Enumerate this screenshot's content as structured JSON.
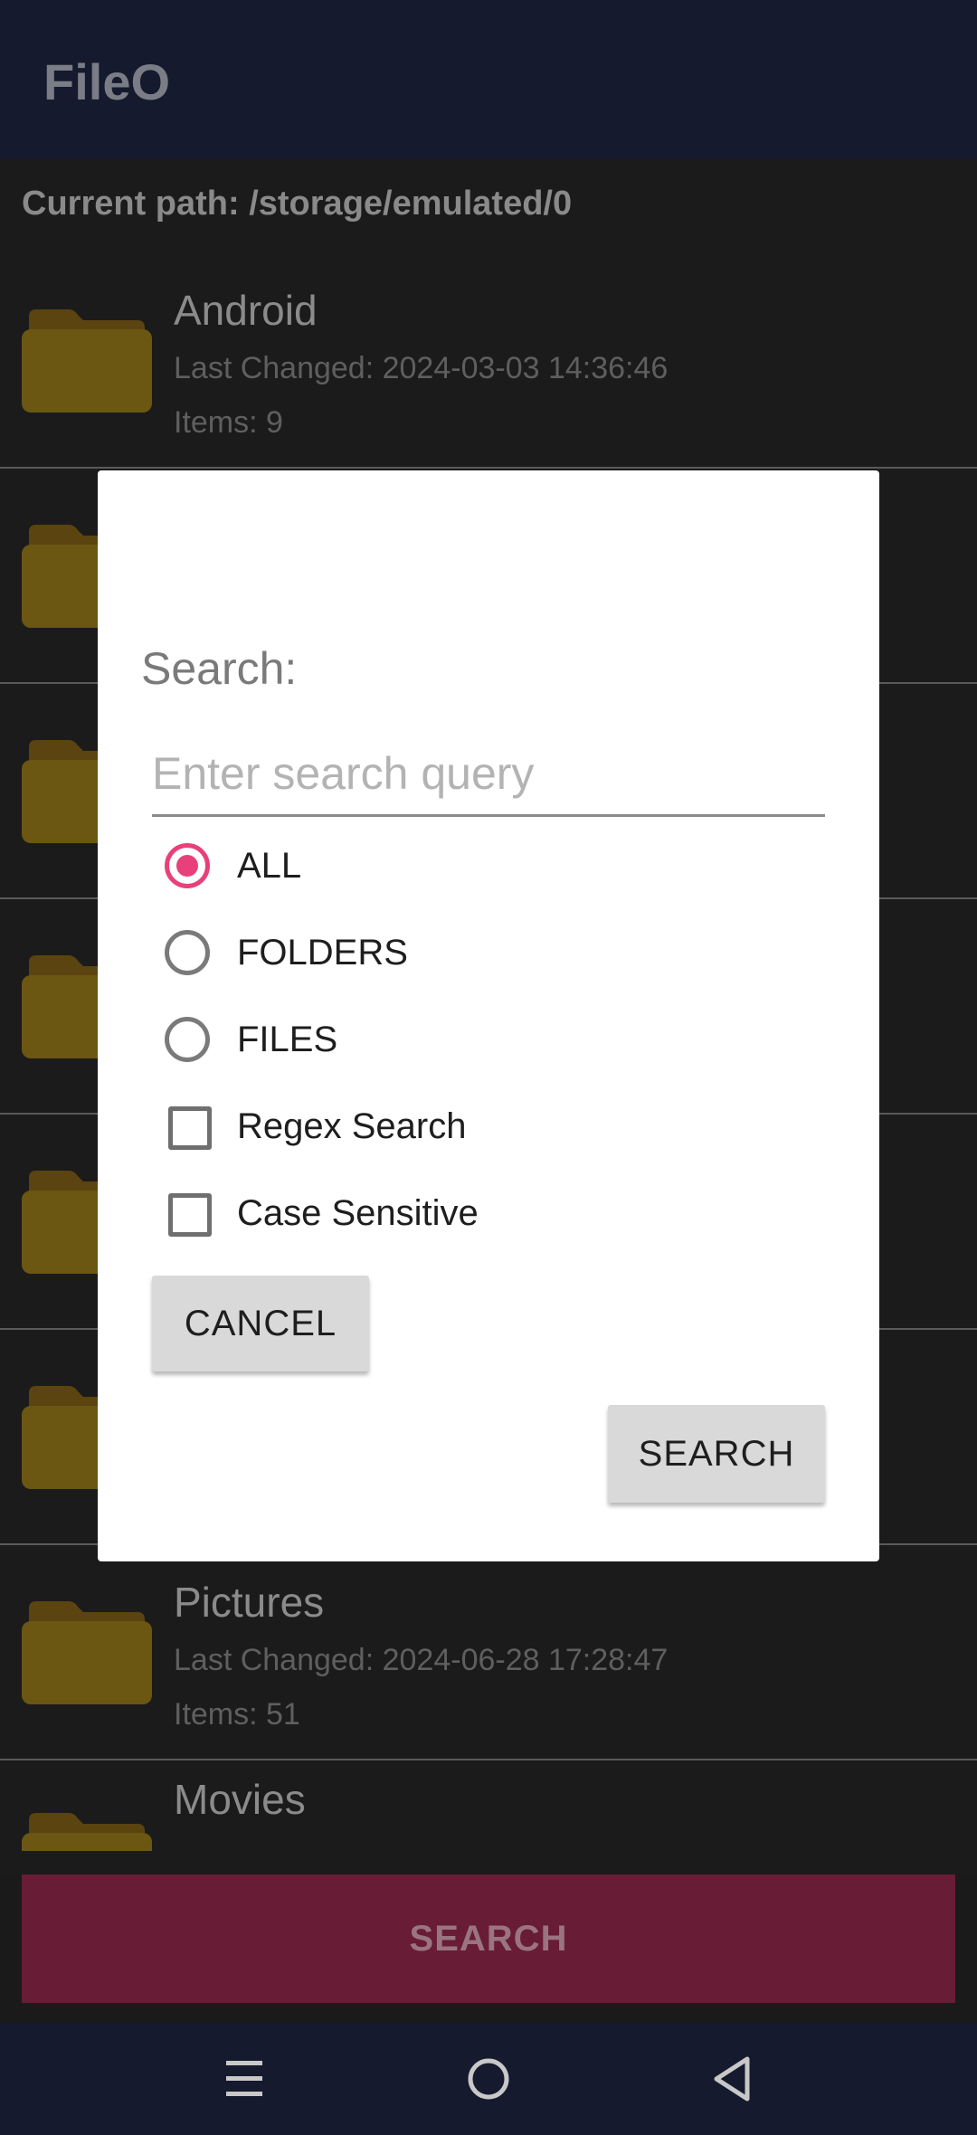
{
  "app": {
    "title": "FileO"
  },
  "path": {
    "label": "Current path: /storage/emulated/0"
  },
  "folders": [
    {
      "name": "Android",
      "date": "Last Changed: 2024-03-03 14:36:46",
      "items": "Items: 9"
    },
    {
      "name": "Pictures",
      "date": "Last Changed: 2024-06-28 17:28:47",
      "items": "Items: 51"
    },
    {
      "name": "Movies"
    }
  ],
  "dialog": {
    "search_label": "Search:",
    "input": {
      "placeholder": "Enter search query",
      "value": ""
    },
    "options": [
      {
        "label": "ALL",
        "type": "radio",
        "checked": true
      },
      {
        "label": "FOLDERS",
        "type": "radio",
        "checked": false
      },
      {
        "label": "FILES",
        "type": "radio",
        "checked": false
      },
      {
        "label": "Regex Search",
        "type": "checkbox",
        "checked": false
      },
      {
        "label": "Case Sensitive",
        "type": "checkbox",
        "checked": false
      }
    ],
    "cancel_label": "CANCEL",
    "search_label_btn": "SEARCH"
  },
  "bottom_button": {
    "label": "SEARCH"
  },
  "colors": {
    "accent": "#e8407a",
    "bottom_button_bg": "#681c36",
    "appbar_bg": "#151a2e"
  },
  "icons": {
    "folder": "folder-icon",
    "nav_menu": "menu-icon",
    "nav_home": "home-icon",
    "nav_back": "back-icon"
  }
}
